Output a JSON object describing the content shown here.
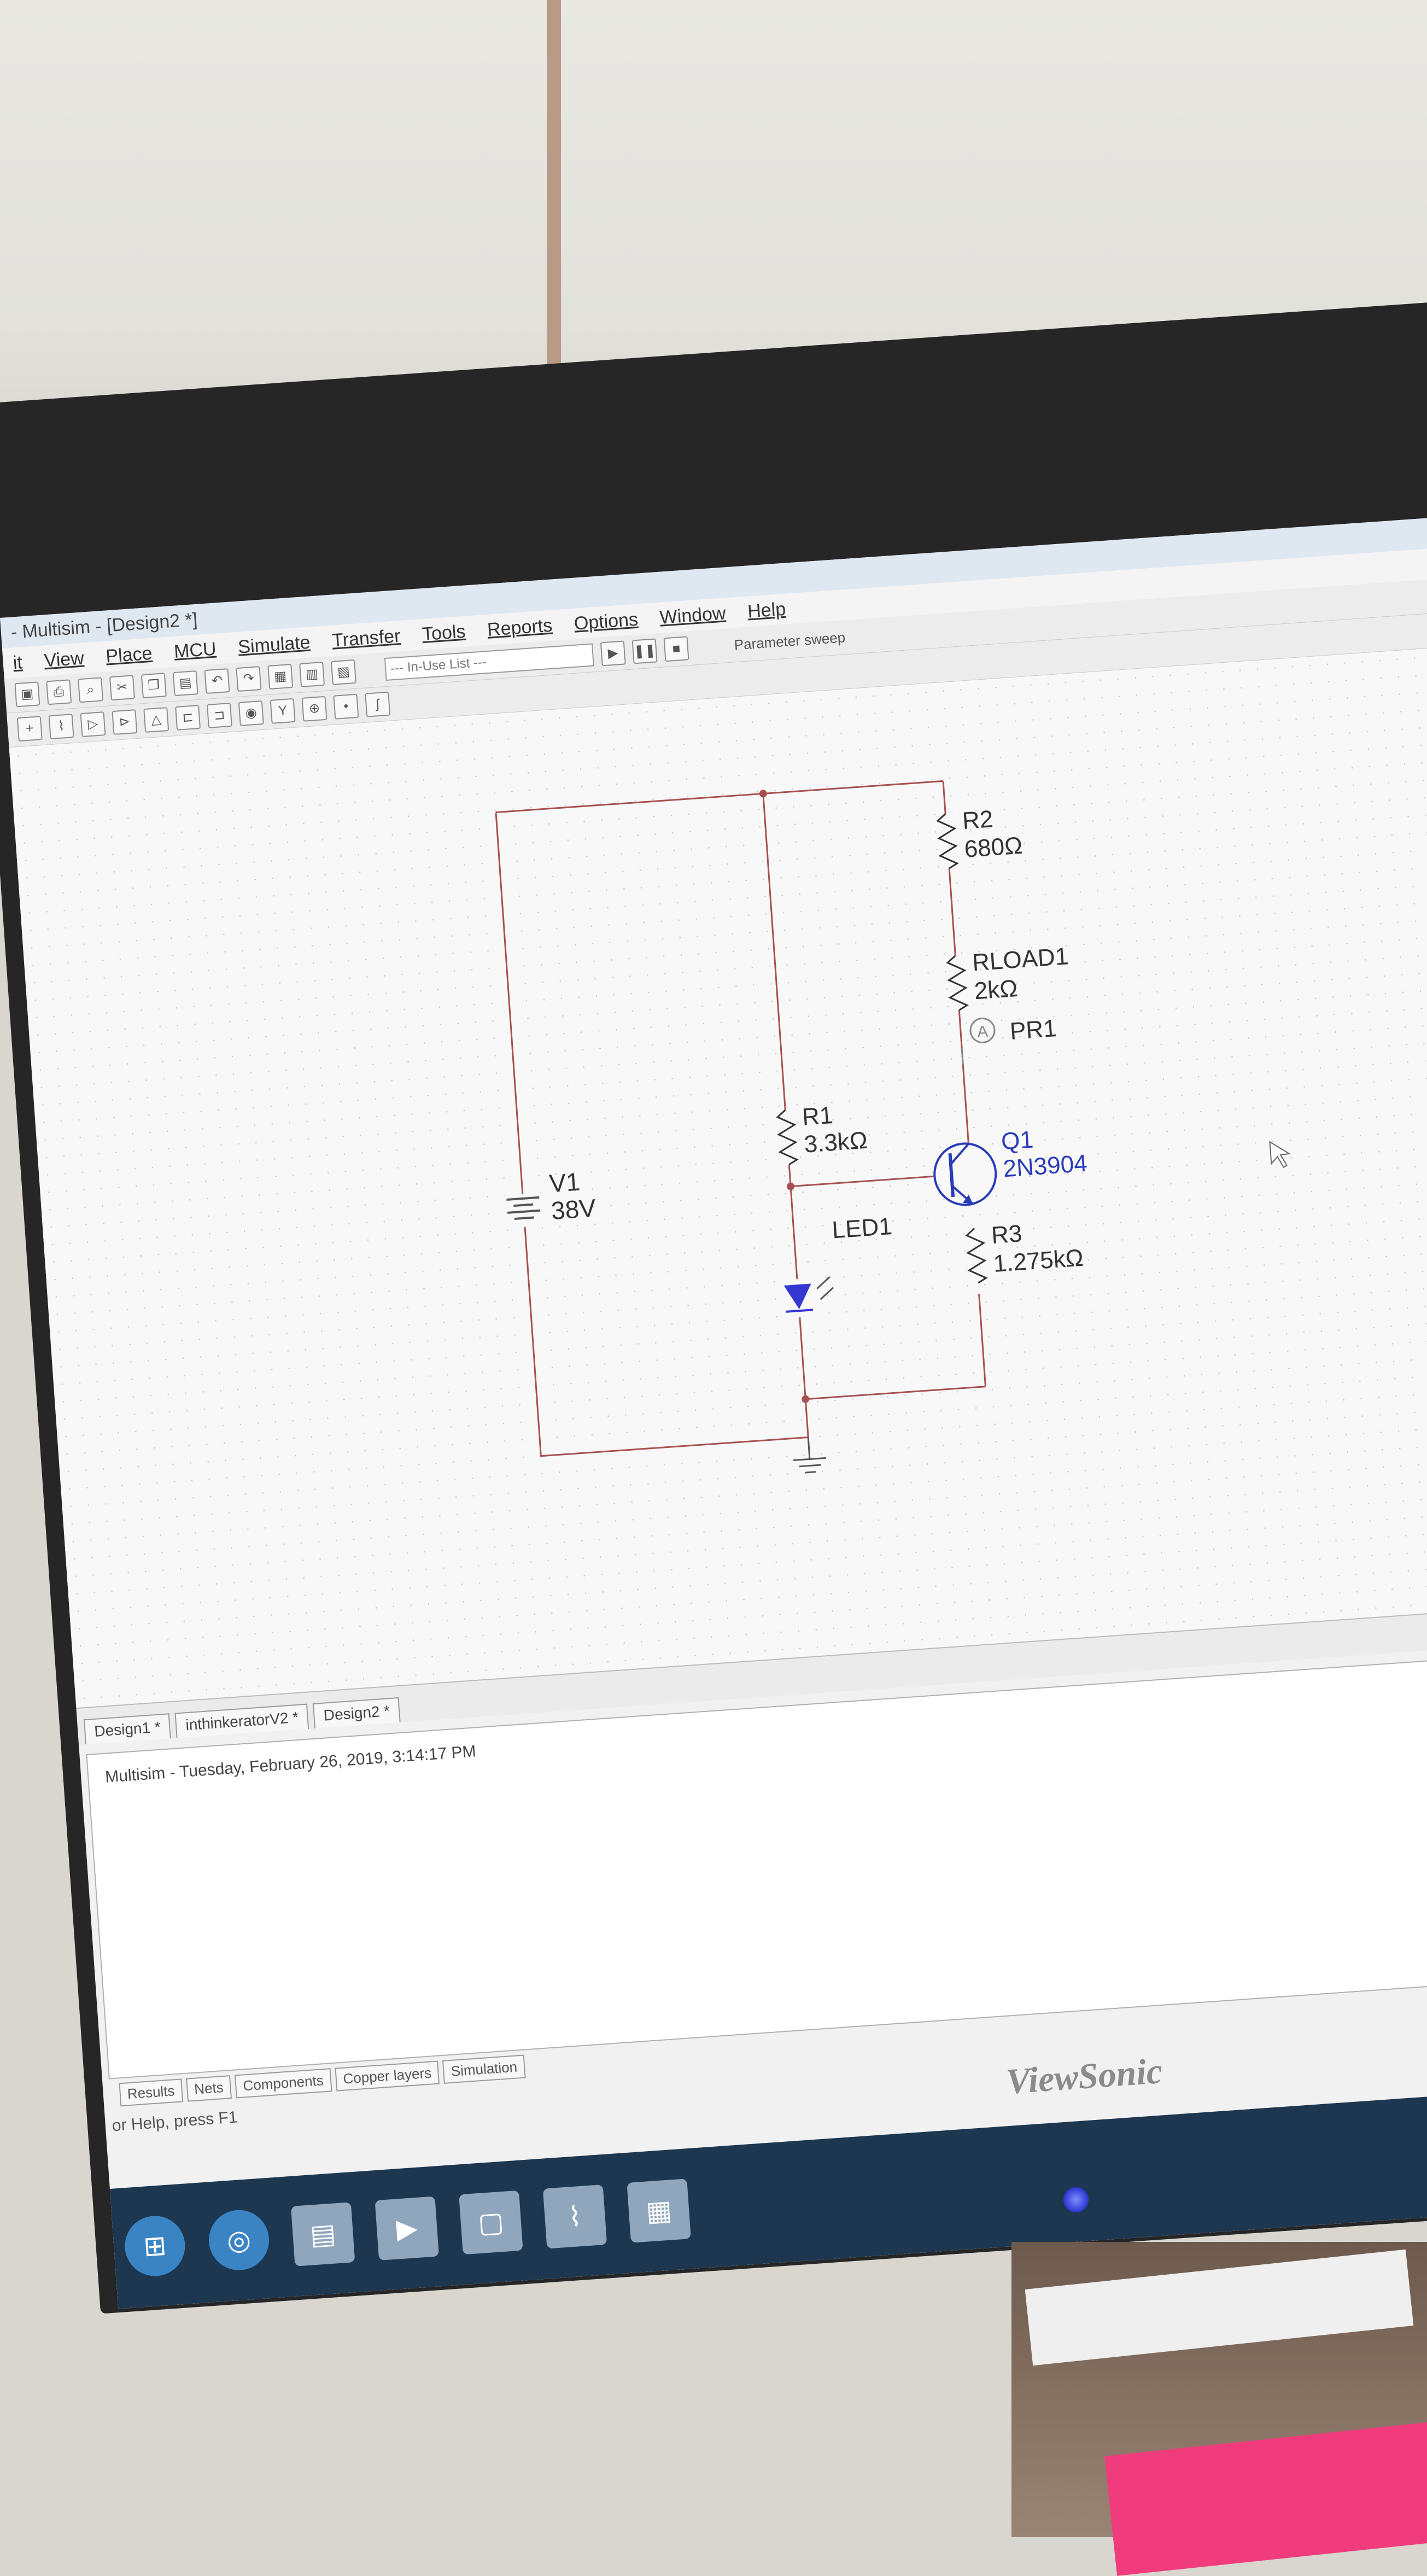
{
  "window": {
    "title": "- Multisim - [Design2 *]"
  },
  "menu": [
    "it",
    "View",
    "Place",
    "MCU",
    "Simulate",
    "Transfer",
    "Tools",
    "Reports",
    "Options",
    "Window",
    "Help"
  ],
  "toolbar": {
    "inuse_list": "--- In-Use List ---",
    "parameter_sweep": "Parameter sweep"
  },
  "schematic": {
    "v1": {
      "name": "V1",
      "value": "38V"
    },
    "r1": {
      "name": "R1",
      "value": "3.3kΩ"
    },
    "r2": {
      "name": "R2",
      "value": "680Ω"
    },
    "rload1": {
      "name": "RLOAD1",
      "value": "2kΩ"
    },
    "pr1": {
      "name": "PR1",
      "symbol": "A"
    },
    "q1": {
      "name": "Q1",
      "value": "2N3904"
    },
    "r3": {
      "name": "R3",
      "value": "1.275kΩ"
    },
    "led1": {
      "name": "LED1"
    }
  },
  "design_tabs": [
    "Design1 *",
    "inthinkeratorV2 *",
    "Design2 *"
  ],
  "output": {
    "log": "Multisim  -  Tuesday, February 26, 2019, 3:14:17 PM"
  },
  "bottom_tabs": [
    "Results",
    "Nets",
    "Components",
    "Copper layers",
    "Simulation"
  ],
  "status": {
    "text": "or Help, press F1"
  },
  "monitor": {
    "brand": "ViewSonic"
  },
  "colors": {
    "wire": "#a85050",
    "led": "#3437d0",
    "transistor": "#2a3bb8"
  }
}
